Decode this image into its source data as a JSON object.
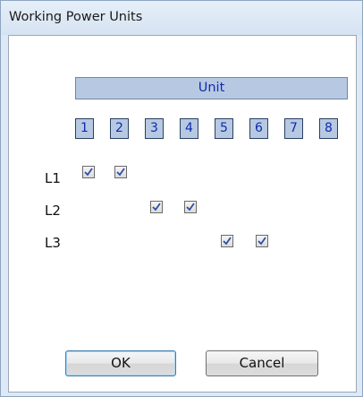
{
  "window": {
    "title": "Working Power Units"
  },
  "unit_header": "Unit",
  "units": [
    "1",
    "2",
    "3",
    "4",
    "5",
    "6",
    "7",
    "8"
  ],
  "rows": [
    {
      "label": "L1",
      "checked_units": [
        1,
        2
      ]
    },
    {
      "label": "L2",
      "checked_units": [
        3,
        4
      ]
    },
    {
      "label": "L3",
      "checked_units": [
        5,
        6
      ]
    }
  ],
  "buttons": {
    "ok": "OK",
    "cancel": "Cancel"
  },
  "colors": {
    "unit_fill": "#b7c9e2",
    "unit_text": "#0f2bb0",
    "title_bg": "#dfe9f5"
  }
}
